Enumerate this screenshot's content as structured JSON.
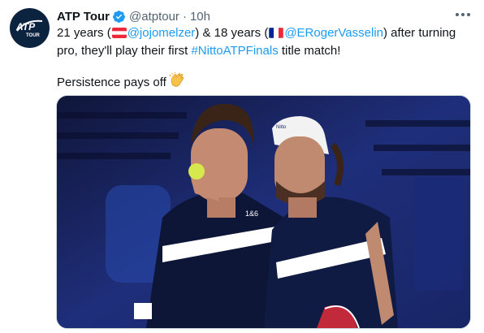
{
  "account": {
    "name": "ATP Tour",
    "handle": "@atptour",
    "separator": "·",
    "time": "10h",
    "logo_text": "ATP TOUR"
  },
  "tweet": {
    "p1": {
      "a": "21 years (",
      "mention1": "@jojomelzer",
      "b": ") & 18 years (",
      "mention2": "@ERogerVasselin",
      "c": ") after turning pro, they'll play their first ",
      "hashtag": "#NittoATPFinals",
      "d": " title match!"
    },
    "p2": "Persistence pays off"
  },
  "icons": {
    "verified": "verified-badge-icon",
    "more": "more-options-icon",
    "flag1": "austria-flag-icon",
    "flag2": "france-flag-icon",
    "clap": "clapping-hands-icon"
  },
  "colors": {
    "link": "#1d9bf0",
    "text": "#0f1419",
    "muted": "#536471",
    "logo_bg": "#0c2340"
  },
  "media": {
    "shirt_text": "1&6",
    "cap_logo_text": "Nitto"
  }
}
